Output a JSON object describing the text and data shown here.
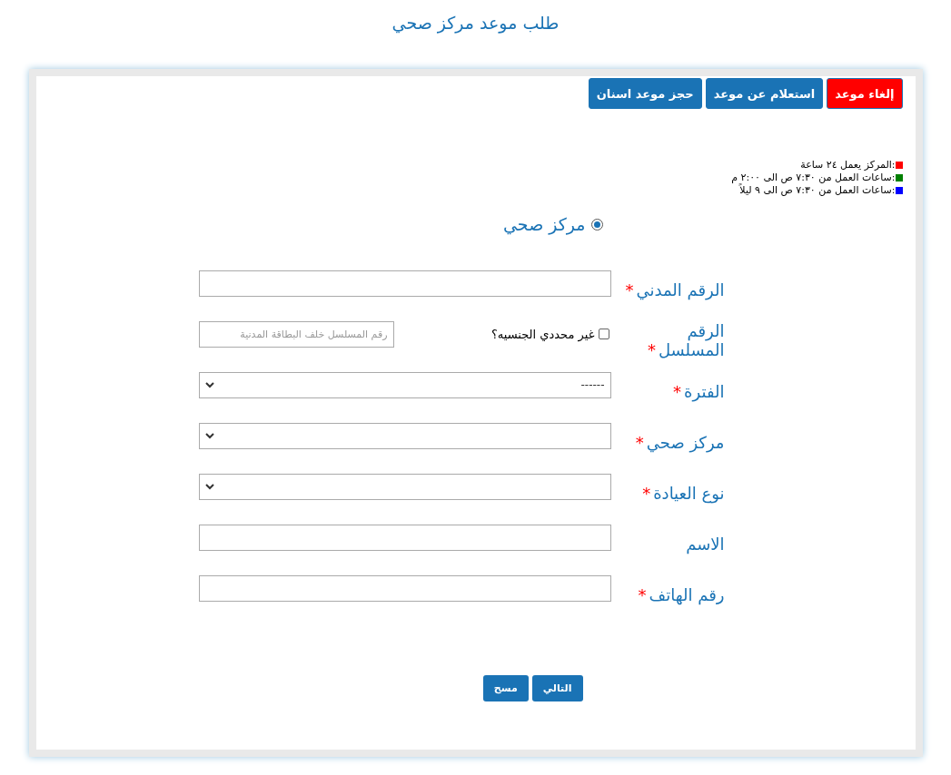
{
  "title": "طلب موعد مركز صحي",
  "actions": [
    {
      "label": "إلغاء موعد",
      "kind": "danger"
    },
    {
      "label": "استعلام عن موعد",
      "kind": "primary"
    },
    {
      "label": "حجز موعد اسنان",
      "kind": "primary"
    }
  ],
  "legend": [
    {
      "text": ":المركز يعمل ٢٤ ساعة",
      "color": "#ff0000"
    },
    {
      "text": ":ساعات العمل من ٧:٣٠ ص الى ٢:٠٠ م",
      "color": "#008000"
    },
    {
      "text": ":ساعات العمل من ٧:٣٠ ص الى ٩ ليلاً",
      "color": "#0000ff"
    }
  ],
  "radios": [
    {
      "label": "مركز صحي",
      "selected": true
    }
  ],
  "fields": [
    {
      "kind": "text",
      "label": "الرقم المدني",
      "mark": "*"
    },
    {
      "kind": "serial",
      "label": "الرقم المسلسل",
      "mark": "*",
      "checkbox": {
        "label": "غير محددي الجنسيه؟",
        "checked": false
      },
      "placeholder": "رقم المسلسل خلف البطاقة المدنية"
    },
    {
      "kind": "select",
      "label": "الفترة",
      "mark": "*",
      "value": "------"
    },
    {
      "kind": "select",
      "label": "مركز صحي",
      "mark": "*"
    },
    {
      "kind": "select",
      "label": "نوع العيادة",
      "mark": "*"
    },
    {
      "kind": "text",
      "label": "الاسم"
    },
    {
      "kind": "text",
      "label": "رقم الهاتف",
      "mark": "*"
    }
  ],
  "buttons": [
    {
      "label": "التالي"
    },
    {
      "label": "مسح"
    }
  ]
}
